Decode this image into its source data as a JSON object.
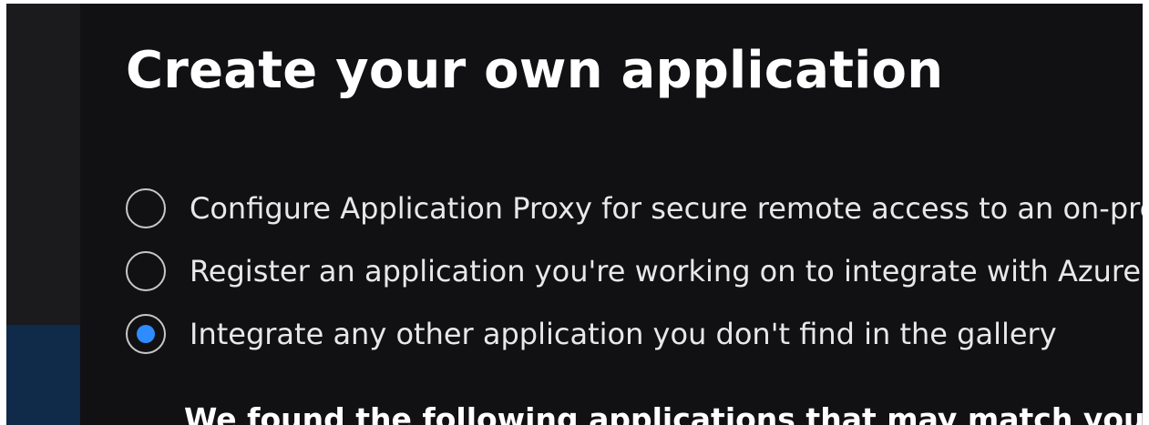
{
  "panel": {
    "title": "Create your own application",
    "options": [
      {
        "label": "Configure Application Proxy for secure remote access to an on-premis",
        "checked": false
      },
      {
        "label": "Register an application you're working on to integrate with Azure AD",
        "checked": false
      },
      {
        "label": "Integrate any other application you don't find in the gallery",
        "checked": true
      }
    ],
    "match_heading": "We found the following applications that may match your entry"
  },
  "colors": {
    "background": "#111113",
    "text": "#e8e8e8",
    "accent": "#2f8cff",
    "indicator": "#2899f5"
  },
  "icons": {
    "radio_unselected": "radio-unselected-icon",
    "radio_selected": "radio-selected-icon"
  }
}
